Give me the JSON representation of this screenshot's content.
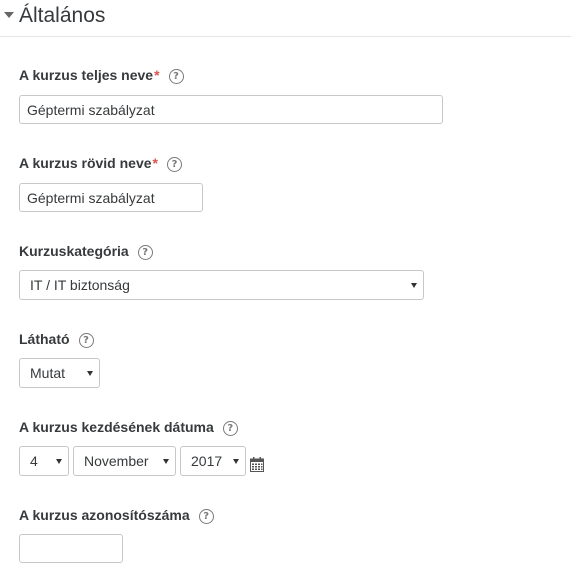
{
  "section": {
    "title": "Általános"
  },
  "fields": {
    "fullname": {
      "label": "A kurzus teljes neve",
      "required_mark": "*",
      "value": "Géptermi szabályzat"
    },
    "shortname": {
      "label": "A kurzus rövid neve",
      "required_mark": "*",
      "value": "Géptermi szabályzat"
    },
    "category": {
      "label": "Kurzuskategória",
      "selected": "IT / IT biztonság"
    },
    "visible": {
      "label": "Látható",
      "selected": "Mutat"
    },
    "startdate": {
      "label": "A kurzus kezdésének dátuma",
      "day": "4",
      "month": "November",
      "year": "2017"
    },
    "idnumber": {
      "label": "A kurzus azonosítószáma",
      "value": ""
    }
  },
  "help_icon_glyph": "?",
  "icons": {
    "collapse": "triangle-down-icon",
    "help": "question-circle-icon",
    "calendar": "calendar-icon"
  },
  "colors": {
    "required": "#d9534f",
    "text": "#373a3c",
    "border": "#c7c7c7"
  }
}
